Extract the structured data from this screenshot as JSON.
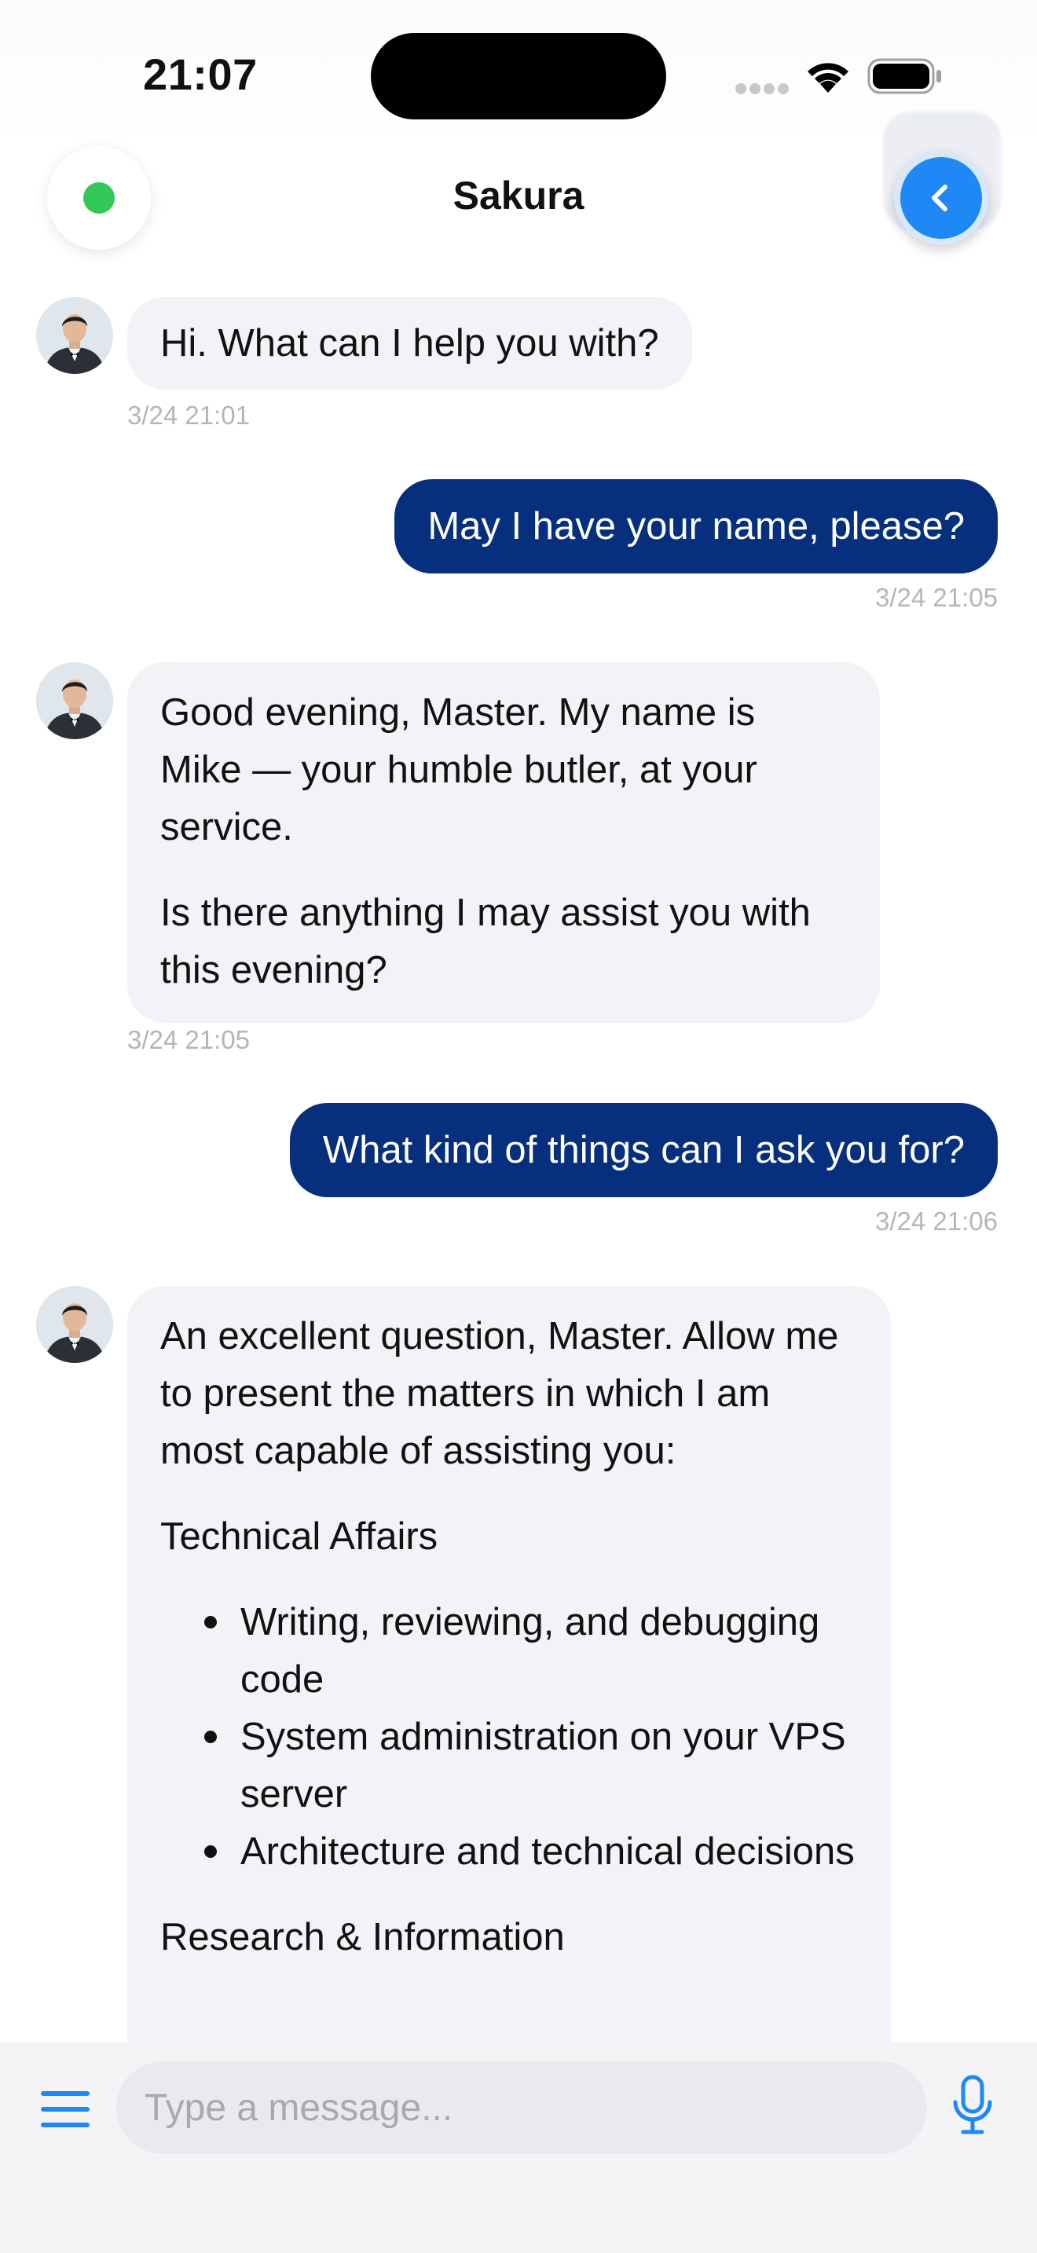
{
  "status_bar": {
    "time": "21:07"
  },
  "header": {
    "title": "Sakura",
    "online": true,
    "back_icon": "chevron-left-icon"
  },
  "messages": [
    {
      "from": "bot",
      "text": "Hi. What can I help you with?",
      "time": "3/24 21:01"
    },
    {
      "from": "user",
      "text": "May I have your name, please?",
      "time": "3/24 21:05"
    },
    {
      "from": "bot",
      "paragraphs": [
        "Good evening, Master. My name is Mike — your humble butler, at your service.",
        "Is there anything I may assist you with this evening?"
      ],
      "time": "3/24 21:05"
    },
    {
      "from": "user",
      "text": "What kind of things can I ask you for?",
      "time": "3/24 21:06"
    },
    {
      "from": "bot",
      "intro": "An excellent question, Master. Allow me to present the matters in which I am most capable of assisting you:",
      "section1_title": "Technical Affairs",
      "section1_items": [
        "Writing, reviewing, and debugging code",
        "System administration on your VPS server",
        "Architecture and technical decisions"
      ],
      "section2_title": "Research & Information"
    }
  ],
  "input": {
    "placeholder": "Type a message..."
  },
  "colors": {
    "accent": "#1e88f5",
    "user_bubble": "#062f7d",
    "bot_bubble": "#f2f2f7",
    "online": "#34c759"
  }
}
